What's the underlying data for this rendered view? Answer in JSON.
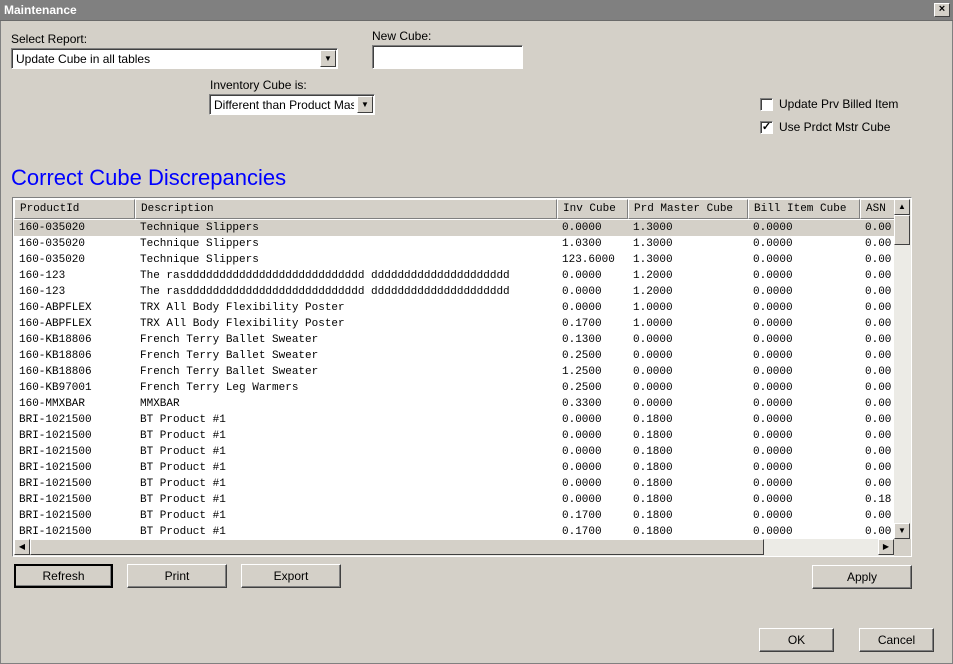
{
  "window": {
    "title": "Maintenance",
    "close_glyph": "×"
  },
  "select_report": {
    "label": "Select Report:",
    "value": "Update Cube in all tables"
  },
  "new_cube": {
    "label": "New Cube:",
    "value": ""
  },
  "inventory_cube": {
    "label": "Inventory Cube is:",
    "value": "Different than Product Mas"
  },
  "checkboxes": [
    {
      "label": "Update Prv Billed Item",
      "checked": false
    },
    {
      "label": "Use Prdct Mstr Cube",
      "checked": true
    }
  ],
  "section_title": "Correct Cube Discrepancies",
  "grid": {
    "columns": [
      "ProductId",
      "Description",
      "Inv Cube",
      "Prd Master Cube",
      "Bill Item Cube",
      "ASN"
    ],
    "rows": [
      [
        "160-035020",
        "Technique Slippers",
        "0.0000",
        "1.3000",
        "0.0000",
        "0.00"
      ],
      [
        "160-035020",
        "Technique Slippers",
        "1.0300",
        "1.3000",
        "0.0000",
        "0.00"
      ],
      [
        "160-035020",
        "Technique Slippers",
        "123.6000",
        "1.3000",
        "0.0000",
        "0.00"
      ],
      [
        "160-123",
        "The rasddddddddddddddddddddddddddd ddddddddddddddddddddd",
        "0.0000",
        "1.2000",
        "0.0000",
        "0.00"
      ],
      [
        "160-123",
        "The rasddddddddddddddddddddddddddd ddddddddddddddddddddd",
        "0.0000",
        "1.2000",
        "0.0000",
        "0.00"
      ],
      [
        "160-ABPFLEX",
        "TRX All Body Flexibility Poster",
        "0.0000",
        "1.0000",
        "0.0000",
        "0.00"
      ],
      [
        "160-ABPFLEX",
        "TRX All Body Flexibility Poster",
        "0.1700",
        "1.0000",
        "0.0000",
        "0.00"
      ],
      [
        "160-KB18806",
        "French Terry Ballet Sweater",
        "0.1300",
        "0.0000",
        "0.0000",
        "0.00"
      ],
      [
        "160-KB18806",
        "French Terry Ballet Sweater",
        "0.2500",
        "0.0000",
        "0.0000",
        "0.00"
      ],
      [
        "160-KB18806",
        "French Terry Ballet Sweater",
        "1.2500",
        "0.0000",
        "0.0000",
        "0.00"
      ],
      [
        "160-KB97001",
        "French Terry Leg Warmers",
        "0.2500",
        "0.0000",
        "0.0000",
        "0.00"
      ],
      [
        "160-MMXBAR",
        "MMXBAR",
        "0.3300",
        "0.0000",
        "0.0000",
        "0.00"
      ],
      [
        "BRI-1021500",
        "BT Product #1",
        "0.0000",
        "0.1800",
        "0.0000",
        "0.00"
      ],
      [
        "BRI-1021500",
        "BT Product #1",
        "0.0000",
        "0.1800",
        "0.0000",
        "0.00"
      ],
      [
        "BRI-1021500",
        "BT Product #1",
        "0.0000",
        "0.1800",
        "0.0000",
        "0.00"
      ],
      [
        "BRI-1021500",
        "BT Product #1",
        "0.0000",
        "0.1800",
        "0.0000",
        "0.00"
      ],
      [
        "BRI-1021500",
        "BT Product #1",
        "0.0000",
        "0.1800",
        "0.0000",
        "0.00"
      ],
      [
        "BRI-1021500",
        "BT Product #1",
        "0.0000",
        "0.1800",
        "0.0000",
        "0.18"
      ],
      [
        "BRI-1021500",
        "BT Product #1",
        "0.1700",
        "0.1800",
        "0.0000",
        "0.00"
      ],
      [
        "BRI-1021500",
        "BT Product #1",
        "0.1700",
        "0.1800",
        "0.0000",
        "0.00"
      ]
    ],
    "selected_row": 0
  },
  "buttons": {
    "refresh": "Refresh",
    "print": "Print",
    "export": "Export",
    "apply": "Apply",
    "ok": "OK",
    "cancel": "Cancel"
  },
  "icons": {
    "dropdown": "chevron-down-icon",
    "scroll_up": "arrow-up-icon",
    "scroll_down": "arrow-down-icon",
    "scroll_left": "arrow-left-icon",
    "scroll_right": "arrow-right-icon",
    "check": "checkmark-icon"
  },
  "colors": {
    "section_title": "#0000ff",
    "window_bg": "#d4d0c8",
    "titlebar": "#808080"
  }
}
